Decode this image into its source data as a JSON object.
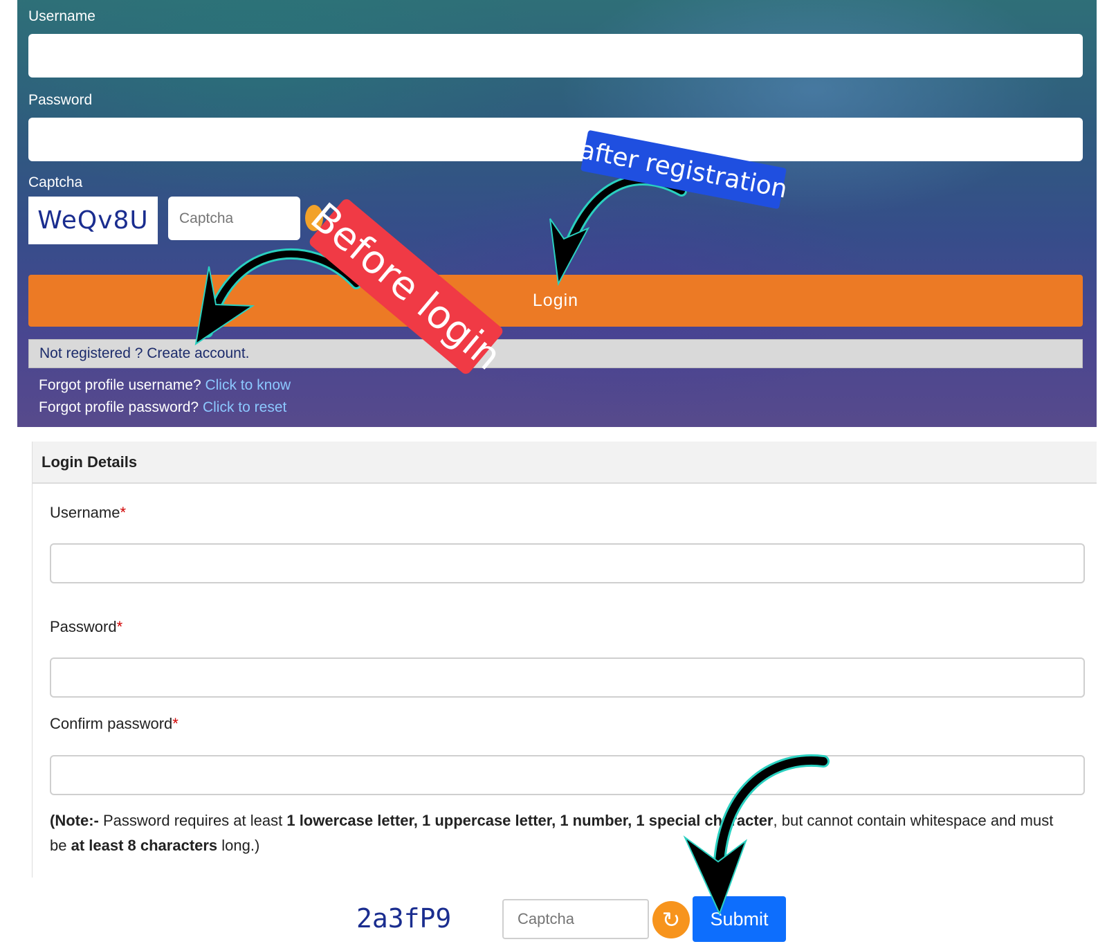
{
  "top_form": {
    "username_label": "Username",
    "password_label": "Password",
    "captcha_label": "Captcha",
    "captcha_code": "WeQv8U",
    "captcha_placeholder": "Captcha",
    "login_label": "Login",
    "register_text": "Not registered ? Create account.",
    "forgot_username_text": "Forgot profile username?",
    "forgot_username_link": "Click to know",
    "forgot_password_text": "Forgot profile password?",
    "forgot_password_link": "Click to reset"
  },
  "annotations": {
    "before_login": "Before login",
    "after_registration": "after registration"
  },
  "login_details": {
    "title": "Login Details",
    "username_label": "Username",
    "password_label": "Password",
    "confirm_password_label": "Confirm password",
    "required_mark": "*",
    "note": {
      "prefix": "(Note:-",
      "text1": " Password requires at least ",
      "rule1": "1 lowercase letter, 1 uppercase letter, 1 number, 1 special character",
      "text2": ", but cannot contain whitespace and must be ",
      "rule2": "at least 8 characters",
      "text3": " long.)"
    },
    "captcha_code": "2a3fP9",
    "captcha_placeholder": "Captcha",
    "submit_label": "Submit"
  },
  "colors": {
    "login_button": "#ec7a25",
    "submit_button": "#0d6efd",
    "before_login_sticker": "#f03a45",
    "after_registration_sticker": "#1f4fe0",
    "required_mark": "#d00000"
  },
  "icons": {
    "refresh": "refresh-icon"
  }
}
